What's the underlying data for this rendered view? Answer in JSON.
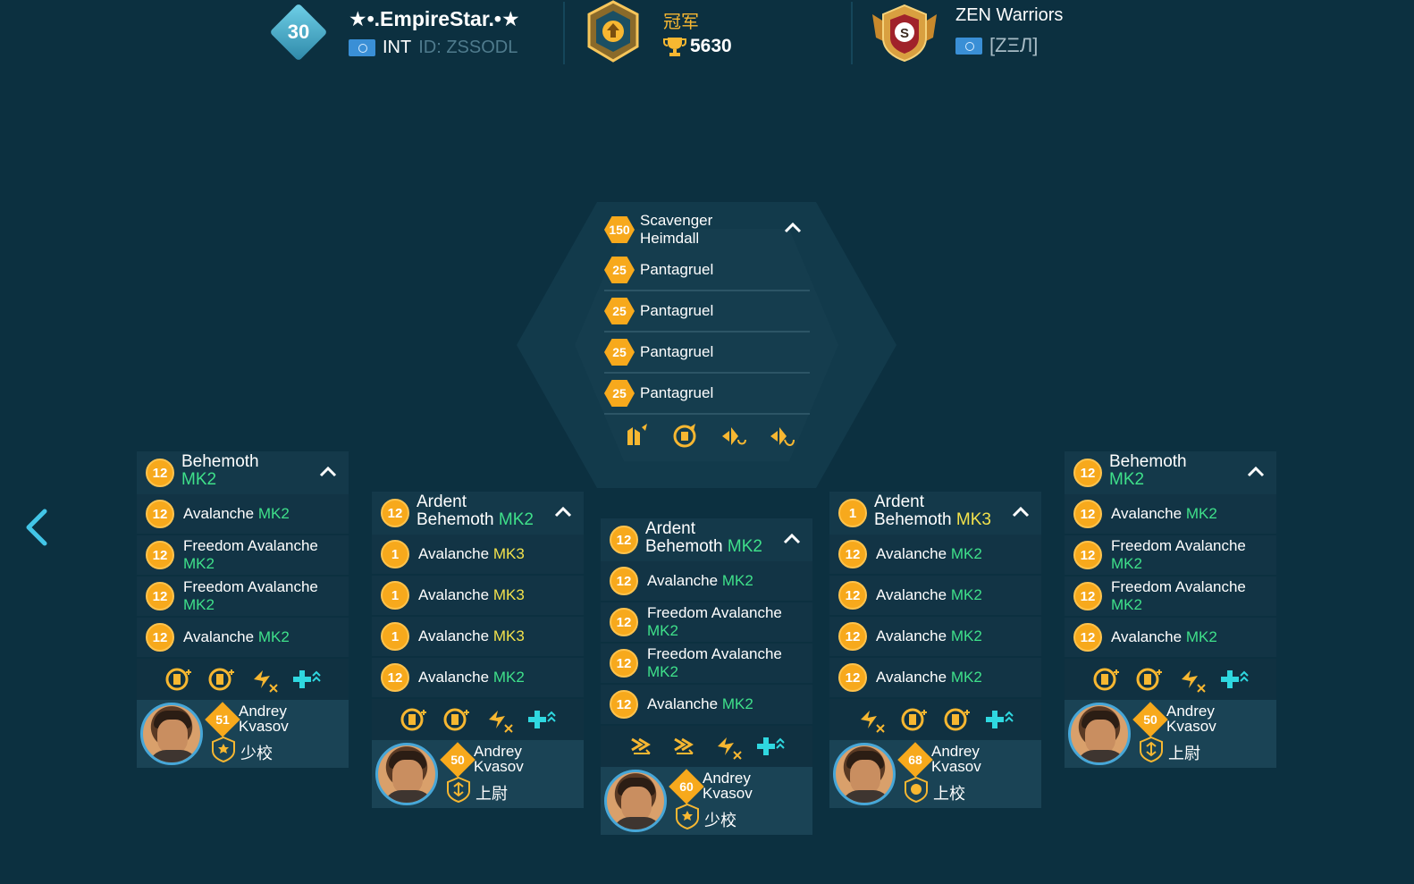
{
  "header": {
    "player": {
      "level": "30",
      "name": "★•.EmpireStar.•★",
      "region": "INT",
      "id_text": "ID: ZSSODL"
    },
    "league": {
      "title": "冠军",
      "score": "5630"
    },
    "clan": {
      "name": "ZEN Warriors",
      "tag": "[ZΞЛ]"
    }
  },
  "center": {
    "rows": [
      {
        "level": "150",
        "name_line1": "Scavenger",
        "name_line2": "Heimdall"
      },
      {
        "level": "25",
        "name": "Pantagruel"
      },
      {
        "level": "25",
        "name": "Pantagruel"
      },
      {
        "level": "25",
        "name": "Pantagruel"
      },
      {
        "level": "25",
        "name": "Pantagruel"
      }
    ]
  },
  "panels": [
    {
      "head": {
        "level": "12",
        "line1": "Behemoth",
        "line2": "",
        "mk": "MK2"
      },
      "rows": [
        {
          "level": "12",
          "name": "Avalanche",
          "mk": "MK2"
        },
        {
          "level": "12",
          "name": "Freedom Avalanche",
          "mk": "MK2"
        },
        {
          "level": "12",
          "name": "Freedom Avalanche",
          "mk": "MK2"
        },
        {
          "level": "12",
          "name": "Avalanche",
          "mk": "MK2"
        }
      ],
      "pilot": {
        "level": "51",
        "first": "Andrey",
        "last": "Kvasov",
        "rank": "少校"
      }
    },
    {
      "head": {
        "level": "12",
        "line1": "Ardent",
        "line2": "Behemoth",
        "mk": "MK2"
      },
      "rows": [
        {
          "level": "1",
          "name": "Avalanche",
          "mk": "MK3"
        },
        {
          "level": "1",
          "name": "Avalanche",
          "mk": "MK3"
        },
        {
          "level": "1",
          "name": "Avalanche",
          "mk": "MK3"
        },
        {
          "level": "12",
          "name": "Avalanche",
          "mk": "MK2"
        }
      ],
      "pilot": {
        "level": "50",
        "first": "Andrey",
        "last": "Kvasov",
        "rank": "上尉"
      }
    },
    {
      "head": {
        "level": "12",
        "line1": "Ardent",
        "line2": "Behemoth",
        "mk": "MK2"
      },
      "rows": [
        {
          "level": "12",
          "name": "Avalanche",
          "mk": "MK2"
        },
        {
          "level": "12",
          "name": "Freedom Avalanche",
          "mk": "MK2"
        },
        {
          "level": "12",
          "name": "Freedom Avalanche",
          "mk": "MK2"
        },
        {
          "level": "12",
          "name": "Avalanche",
          "mk": "MK2"
        }
      ],
      "pilot": {
        "level": "60",
        "first": "Andrey",
        "last": "Kvasov",
        "rank": "少校"
      }
    },
    {
      "head": {
        "level": "1",
        "line1": "Ardent",
        "line2": "Behemoth",
        "mk": "MK3"
      },
      "rows": [
        {
          "level": "12",
          "name": "Avalanche",
          "mk": "MK2"
        },
        {
          "level": "12",
          "name": "Avalanche",
          "mk": "MK2"
        },
        {
          "level": "12",
          "name": "Avalanche",
          "mk": "MK2"
        },
        {
          "level": "12",
          "name": "Avalanche",
          "mk": "MK2"
        }
      ],
      "pilot": {
        "level": "68",
        "first": "Andrey",
        "last": "Kvasov",
        "rank": "上校"
      }
    },
    {
      "head": {
        "level": "12",
        "line1": "Behemoth",
        "line2": "",
        "mk": "MK2"
      },
      "rows": [
        {
          "level": "12",
          "name": "Avalanche",
          "mk": "MK2"
        },
        {
          "level": "12",
          "name": "Freedom Avalanche",
          "mk": "MK2"
        },
        {
          "level": "12",
          "name": "Freedom Avalanche",
          "mk": "MK2"
        },
        {
          "level": "12",
          "name": "Avalanche",
          "mk": "MK2"
        }
      ],
      "pilot": {
        "level": "50",
        "first": "Andrey",
        "last": "Kvasov",
        "rank": "上尉"
      }
    }
  ],
  "colors": {
    "background": "#0c3040",
    "accent_gold": "#f7a91c",
    "mk2": "#3fe08a",
    "mk3": "#f3e24c",
    "perk_cyan": "#2fd8e0"
  }
}
